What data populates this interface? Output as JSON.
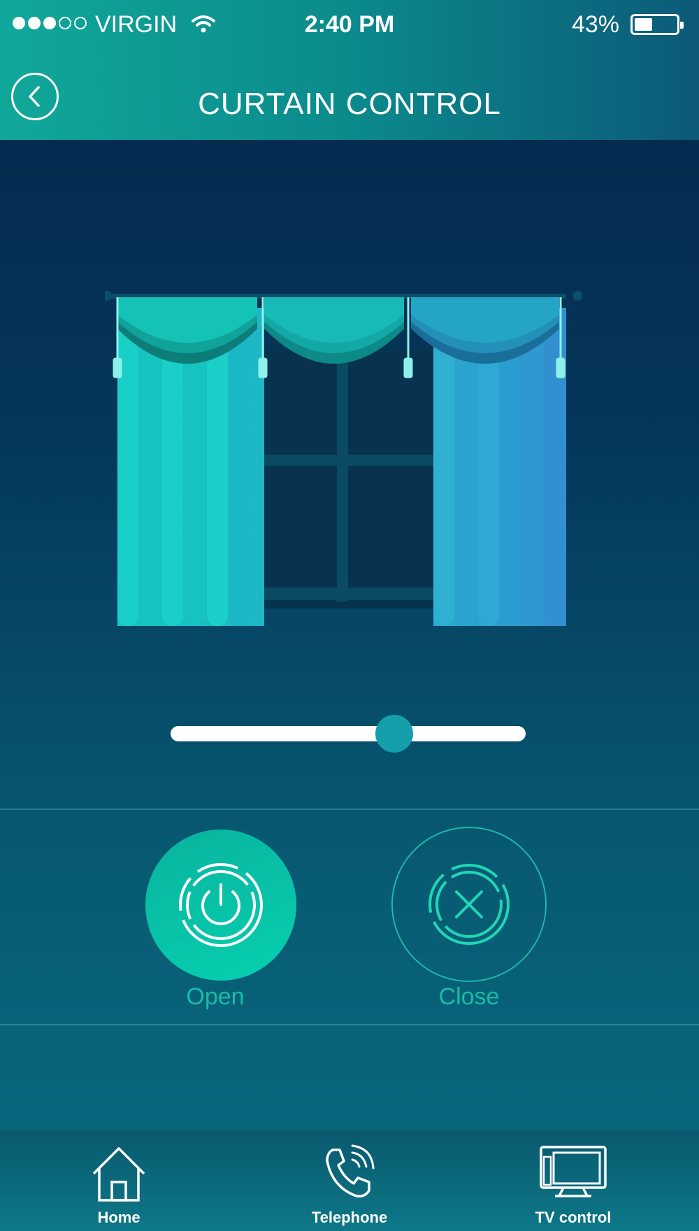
{
  "status_bar": {
    "carrier": "VIRGIN",
    "time": "2:40 PM",
    "battery_percent": "43%",
    "battery_level": 0.43,
    "signal_bars": 3,
    "signal_total": 5
  },
  "header": {
    "title": "CURTAIN CONTROL",
    "back_icon": "chevron-left-icon"
  },
  "curtain": {
    "illustration": "curtain-illustration",
    "colors": {
      "left_panel": "#16c6c0",
      "right_panel": "#2b9ad0",
      "window_frame": "#0b4a63"
    }
  },
  "slider": {
    "value": 0.63,
    "thumb_color": "#149fab"
  },
  "controls": {
    "open_label": "Open",
    "close_label": "Close",
    "open_icon": "power-icon",
    "close_icon": "close-icon",
    "accent": "#16bca8"
  },
  "tabbar": {
    "items": [
      {
        "label": "Home",
        "icon": "home-icon"
      },
      {
        "label": "Telephone",
        "icon": "phone-icon"
      },
      {
        "label": "TV control",
        "icon": "tv-icon"
      }
    ]
  }
}
